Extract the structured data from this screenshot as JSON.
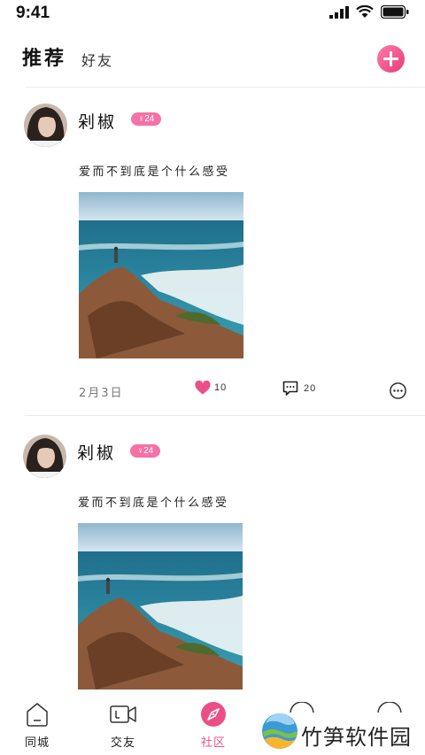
{
  "status_bar": {
    "time": "9:41"
  },
  "header": {
    "tab_recommend": "推荐",
    "tab_friends": "好友"
  },
  "posts": [
    {
      "username": "剁椒",
      "badge": "♀24",
      "content": "爱而不到底是个什么感受",
      "date": "2月3日",
      "likes": "10",
      "comments": "20"
    },
    {
      "username": "剁椒",
      "badge": "♀24",
      "content": "爱而不到底是个什么感受"
    }
  ],
  "tab_bar": {
    "items": [
      {
        "label": "同城",
        "icon": "home-icon"
      },
      {
        "label": "交友",
        "icon": "video-call-icon"
      },
      {
        "label": "社区",
        "icon": "compass-icon",
        "active": true
      }
    ],
    "active_color": "#e84f8b"
  },
  "watermark": {
    "text": "竹笋软件园"
  },
  "colors": {
    "accent": "#ec4f88",
    "badge": "#f472a6"
  }
}
